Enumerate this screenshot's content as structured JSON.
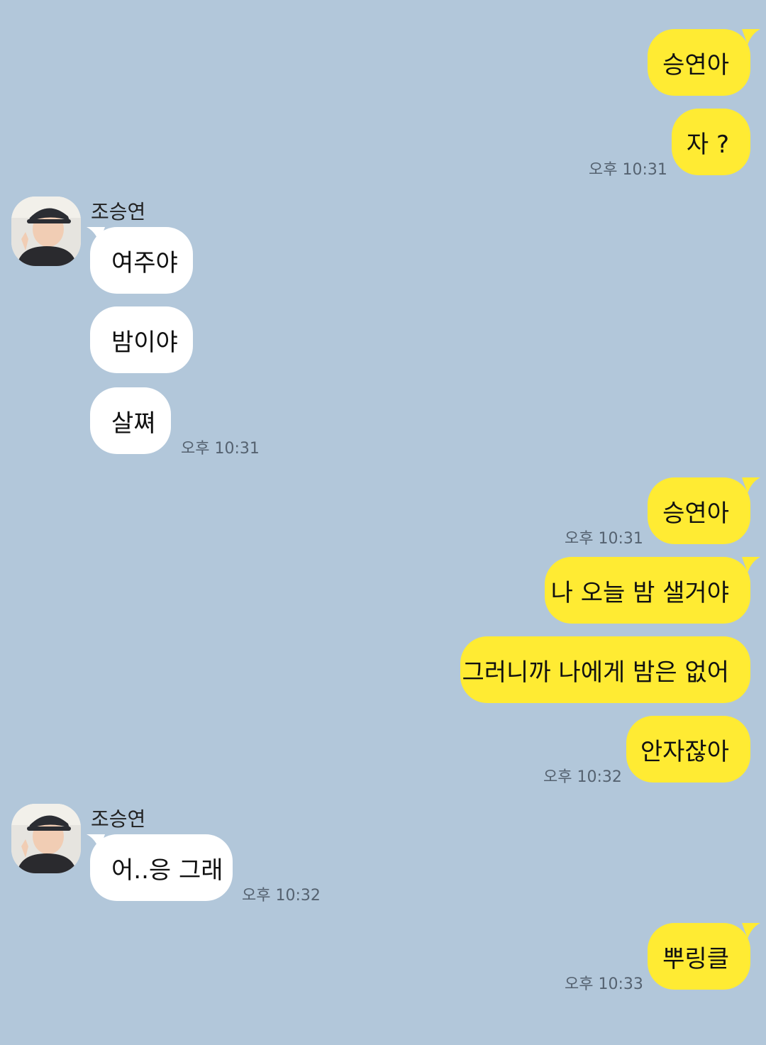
{
  "sender": {
    "name": "조승연"
  },
  "messages": {
    "m1": "승연아",
    "m2": "자 ?",
    "t1": "오후 10:31",
    "m3": "여주야",
    "m4": "밤이야",
    "m5": "살쪄",
    "t2": "오후 10:31",
    "m6": "승연아",
    "t3": "오후 10:31",
    "m7": "나 오늘 밤 샐거야",
    "m8": "그러니까 나에게 밤은 없어",
    "m9": "안자잖아",
    "t4": "오후 10:32",
    "m10": "어..응 그래",
    "t5": "오후 10:32",
    "m11": "뿌링클",
    "t6": "오후 10:33"
  },
  "colors": {
    "background": "#b2c7da",
    "my_bubble": "#ffeb33",
    "other_bubble": "#ffffff"
  },
  "icons": {
    "avatar": "profile-photo-avatar"
  }
}
